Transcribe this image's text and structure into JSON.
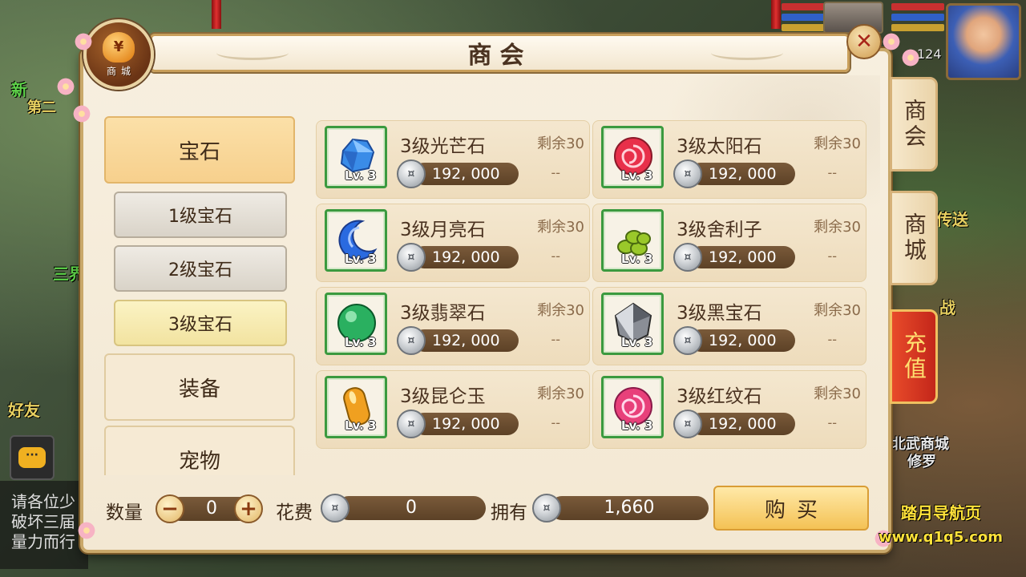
{
  "shop": {
    "title": "商会",
    "emblem_symbol": "¥",
    "emblem_label": "商城",
    "close_symbol": "✕"
  },
  "side_tabs": [
    {
      "label": "商会",
      "active": true
    },
    {
      "label": "商城",
      "active": false
    },
    {
      "label": "充值",
      "active": false
    }
  ],
  "categories": {
    "main": [
      {
        "label": "宝石",
        "active": true
      },
      {
        "label": "装备",
        "active": false
      },
      {
        "label": "宠物",
        "active": false
      }
    ],
    "sub": [
      {
        "label": "1级宝石",
        "active": false
      },
      {
        "label": "2级宝石",
        "active": false
      },
      {
        "label": "3级宝石",
        "active": true
      }
    ]
  },
  "items": [
    {
      "name": "3级光芒石",
      "level": "Lv. 3",
      "remaining": "剩余30",
      "price": "192, 000",
      "dash": "--",
      "icon": "blue-crystal-icon",
      "color": "#3a8ce8"
    },
    {
      "name": "3级太阳石",
      "level": "Lv. 3",
      "remaining": "剩余30",
      "price": "192, 000",
      "dash": "--",
      "icon": "red-swirl-orb-icon",
      "color": "#e8304a"
    },
    {
      "name": "3级月亮石",
      "level": "Lv. 3",
      "remaining": "剩余30",
      "price": "192, 000",
      "dash": "--",
      "icon": "blue-crescent-icon",
      "color": "#2a6ae0"
    },
    {
      "name": "3级舍利子",
      "level": "Lv. 3",
      "remaining": "剩余30",
      "price": "192, 000",
      "dash": "--",
      "icon": "green-beads-icon",
      "color": "#9ac82a"
    },
    {
      "name": "3级翡翠石",
      "level": "Lv. 3",
      "remaining": "剩余30",
      "price": "192, 000",
      "dash": "--",
      "icon": "green-orb-icon",
      "color": "#2ab060"
    },
    {
      "name": "3级黑宝石",
      "level": "Lv. 3",
      "remaining": "剩余30",
      "price": "192, 000",
      "dash": "--",
      "icon": "black-diamond-icon",
      "color": "#8a8e96"
    },
    {
      "name": "3级昆仑玉",
      "level": "Lv. 3",
      "remaining": "剩余30",
      "price": "192, 000",
      "dash": "--",
      "icon": "amber-jade-icon",
      "color": "#f0a020"
    },
    {
      "name": "3级红纹石",
      "level": "Lv. 3",
      "remaining": "剩余30",
      "price": "192, 000",
      "dash": "--",
      "icon": "pink-swirl-orb-icon",
      "color": "#e8407a"
    }
  ],
  "bottom": {
    "quantity_label": "数量",
    "quantity_value": "0",
    "minus": "−",
    "plus": "+",
    "cost_label": "花费",
    "cost_value": "0",
    "owned_label": "拥有",
    "owned_value": "1,660",
    "buy_label": "购买"
  },
  "coin_symbol": "¤",
  "background": {
    "chat_lines": [
      "请各位少",
      "破坏三届",
      "量力而行"
    ],
    "friends_label": "好友",
    "level": "124",
    "scene_texts": [
      "新",
      "第二",
      "三界",
      "传送",
      "北武商城",
      "修罗",
      "战"
    ]
  },
  "watermark": {
    "line1": "踏月导航页",
    "line2": "www.q1q5.com"
  }
}
